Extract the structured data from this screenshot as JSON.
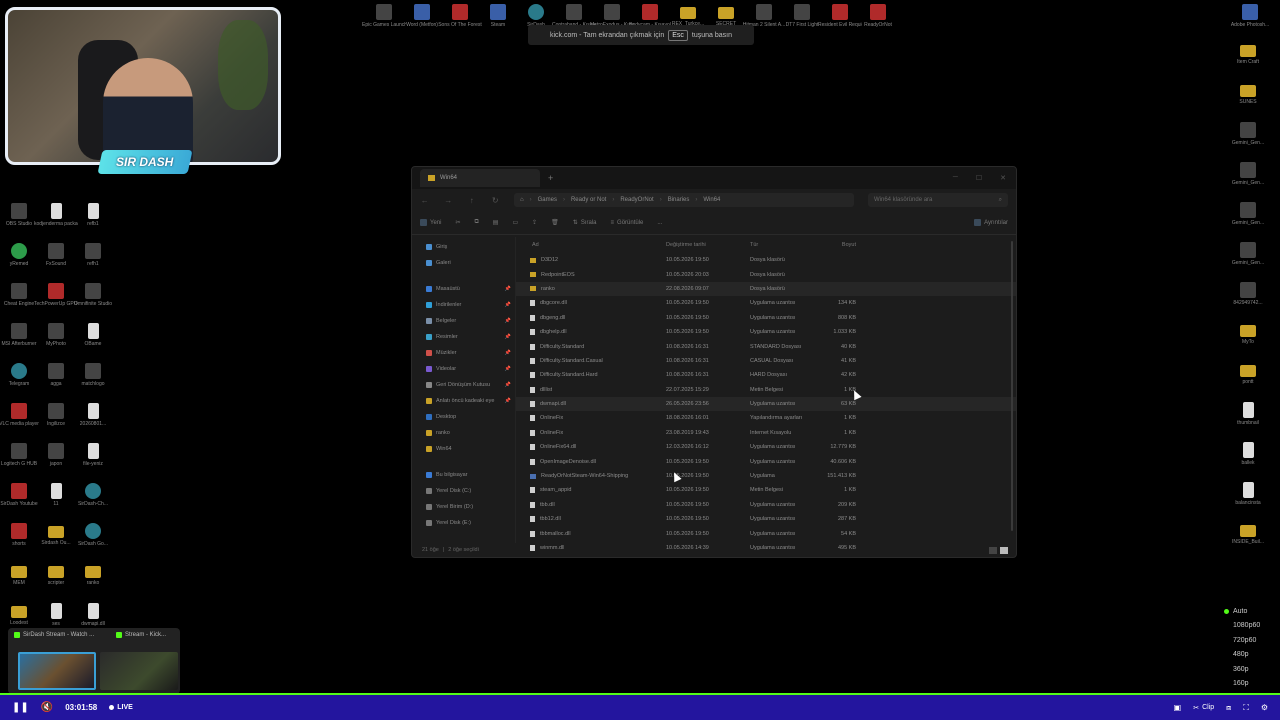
{
  "toast": {
    "text_before": "kick.com - Tam ekrandan çıkmak için",
    "key": "Esc",
    "text_after": "tuşuna basın"
  },
  "webcam": {
    "badge": "SIR DASH"
  },
  "desktop_top": [
    {
      "label": "Epic Games Launcher",
      "kind": "dark"
    },
    {
      "label": "Word (Metfon)",
      "kind": "app"
    },
    {
      "label": "Sons Of The Forest",
      "kind": "red"
    },
    {
      "label": "Steam",
      "kind": "app"
    },
    {
      "label": "SirDash",
      "kind": "teal"
    },
    {
      "label": "Contraband - Kısayol",
      "kind": "dark"
    },
    {
      "label": "MetroExodus - Kısayol",
      "kind": "dark"
    },
    {
      "label": "Bodycam - Kısayol",
      "kind": "red"
    },
    {
      "label": "REX_Turkce...",
      "kind": "folder"
    },
    {
      "label": "SECRET",
      "kind": "folder"
    },
    {
      "label": "Hitman 2 Silent A...",
      "kind": "dark"
    },
    {
      "label": "DT7 First Light",
      "kind": "dark"
    },
    {
      "label": "Resident Evil Requiem",
      "kind": "red"
    },
    {
      "label": "ReadyOrNot",
      "kind": "red"
    },
    {
      "label": "Adobe Photosh...",
      "kind": "app"
    }
  ],
  "desktop_left": [
    {
      "label": "OBS Studio",
      "kind": "dark"
    },
    {
      "label": "kodjenderma packagedel...",
      "kind": "file"
    },
    {
      "label": "refb1",
      "kind": "file"
    },
    {
      "label": "yRemed",
      "kind": "green"
    },
    {
      "label": "FxSound",
      "kind": "dark"
    },
    {
      "label": "refh1",
      "kind": "dark"
    },
    {
      "label": "Cheat Engine",
      "kind": "dark"
    },
    {
      "label": "TechPowerUp GPU-Z",
      "kind": "red"
    },
    {
      "label": "Omnifinite Studio",
      "kind": "dark"
    },
    {
      "label": "MSI Afterburner",
      "kind": "dark"
    },
    {
      "label": "MyPhoto",
      "kind": "dark"
    },
    {
      "label": "OBame",
      "kind": "file"
    },
    {
      "label": "Telegram",
      "kind": "teal"
    },
    {
      "label": "agga",
      "kind": "dark"
    },
    {
      "label": "matchlogo",
      "kind": "dark"
    },
    {
      "label": "VLC media player",
      "kind": "red"
    },
    {
      "label": "İngilizce",
      "kind": "dark"
    },
    {
      "label": "20260801...",
      "kind": "file"
    },
    {
      "label": "Logitech G HUB",
      "kind": "dark"
    },
    {
      "label": "japon",
      "kind": "dark"
    },
    {
      "label": "file-yeniz",
      "kind": "file"
    },
    {
      "label": "SirDash Youtube",
      "kind": "red"
    },
    {
      "label": "11",
      "kind": "file"
    },
    {
      "label": "SirDash-Ch...",
      "kind": "teal"
    },
    {
      "label": "shorts",
      "kind": "red"
    },
    {
      "label": "Sirdash Ou...",
      "kind": "folder"
    },
    {
      "label": "SirDash Go...",
      "kind": "teal"
    },
    {
      "label": "MEM",
      "kind": "folder"
    },
    {
      "label": "scripter",
      "kind": "folder"
    },
    {
      "label": "ranko",
      "kind": "folder"
    },
    {
      "label": "Loodest",
      "kind": "folder"
    },
    {
      "label": "ses",
      "kind": "file"
    },
    {
      "label": "dwmapi.dll",
      "kind": "file"
    }
  ],
  "desktop_right": [
    {
      "label": "Item Craft",
      "kind": "folder"
    },
    {
      "label": "SUNES",
      "kind": "folder"
    },
    {
      "label": "Gemini_Gen...",
      "kind": "dark"
    },
    {
      "label": "Gemini_Gen...",
      "kind": "dark"
    },
    {
      "label": "Gemini_Gen...",
      "kind": "dark"
    },
    {
      "label": "Gemini_Gen...",
      "kind": "dark"
    },
    {
      "label": "842949742...",
      "kind": "dark"
    },
    {
      "label": "MyTo",
      "kind": "folder"
    },
    {
      "label": "pontt",
      "kind": "folder"
    },
    {
      "label": "thumbnail",
      "kind": "file"
    },
    {
      "label": "ballek",
      "kind": "file"
    },
    {
      "label": "balancinsta",
      "kind": "file"
    },
    {
      "label": "INSIDE_Buil...",
      "kind": "folder"
    }
  ],
  "explorer": {
    "tab_title": "Win64",
    "path": [
      "Games",
      "Ready or Not",
      "ReadyOrNot",
      "Binaries",
      "Win64"
    ],
    "search_placeholder": "Win64 klasöründe ara",
    "toolbar": {
      "new": "Yeni",
      "sort": "Sırala",
      "view": "Görüntüle",
      "more": "...",
      "details": "Ayrıntılar"
    },
    "nav_pane": {
      "top": [
        {
          "label": "Giriş",
          "icon": "home"
        },
        {
          "label": "Galeri",
          "icon": "gallery"
        }
      ],
      "quick": [
        {
          "label": "Masaüstü",
          "pinned": true
        },
        {
          "label": "İndirilenler",
          "pinned": true
        },
        {
          "label": "Belgeler",
          "pinned": true
        },
        {
          "label": "Resimler",
          "pinned": true
        },
        {
          "label": "Müzikler",
          "pinned": true
        },
        {
          "label": "Videolar",
          "pinned": true
        },
        {
          "label": "Geri Dönüşüm Kutusu",
          "pinned": true
        },
        {
          "label": "Anlatı öncü kadeaki eye",
          "pinned": true
        },
        {
          "label": "Desktop",
          "pinned": false
        },
        {
          "label": "ranko",
          "pinned": false
        },
        {
          "label": "Win64",
          "pinned": false
        }
      ],
      "this_pc": "Bu bilgisayar",
      "drives": [
        "Yerel Disk (C:)",
        "Yerel Birim (D:)",
        "Yerel Disk (E:)"
      ]
    },
    "columns": {
      "name": "Ad",
      "date": "Değiştirme tarihi",
      "type": "Tür",
      "size": "Boyut"
    },
    "files": [
      {
        "name": "D3D12",
        "date": "10.05.2026 19:50",
        "type": "Dosya klasörü",
        "size": "",
        "kind": "folder",
        "selected": false
      },
      {
        "name": "RedpointEOS",
        "date": "10.05.2026 20:03",
        "type": "Dosya klasörü",
        "size": "",
        "kind": "folder",
        "selected": false
      },
      {
        "name": "ranko",
        "date": "22.08.2026 09:07",
        "type": "Dosya klasörü",
        "size": "",
        "kind": "folder",
        "selected": true
      },
      {
        "name": "dbgcore.dll",
        "date": "10.05.2026 19:50",
        "type": "Uygulama uzantısı",
        "size": "134 KB",
        "kind": "file",
        "selected": false
      },
      {
        "name": "dbgeng.dll",
        "date": "10.05.2026 19:50",
        "type": "Uygulama uzantısı",
        "size": "808 KB",
        "kind": "file",
        "selected": false
      },
      {
        "name": "dbghelp.dll",
        "date": "10.05.2026 19:50",
        "type": "Uygulama uzantısı",
        "size": "1.033 KB",
        "kind": "file",
        "selected": false
      },
      {
        "name": "Difficulty.Standard",
        "date": "10.08.2026 16:31",
        "type": "STANDARD Dosyası",
        "size": "40 KB",
        "kind": "file",
        "selected": false
      },
      {
        "name": "Difficulty.Standard.Casual",
        "date": "10.08.2026 16:31",
        "type": "CASUAL Dosyası",
        "size": "41 KB",
        "kind": "file",
        "selected": false
      },
      {
        "name": "Difficulty.Standard.Hard",
        "date": "10.08.2026 16:31",
        "type": "HARD Dosyası",
        "size": "42 KB",
        "kind": "file",
        "selected": false
      },
      {
        "name": "dlllist",
        "date": "22.07.2025 15:29",
        "type": "Metin Belgesi",
        "size": "1 KB",
        "kind": "file",
        "selected": false
      },
      {
        "name": "dwmapi.dll",
        "date": "26.05.2026 23:56",
        "type": "Uygulama uzantısı",
        "size": "63 KB",
        "kind": "file",
        "selected": true
      },
      {
        "name": "OnlineFix",
        "date": "18.08.2026 16:01",
        "type": "Yapılandırma ayarları",
        "size": "1 KB",
        "kind": "file",
        "selected": false
      },
      {
        "name": "OnlineFix",
        "date": "23.08.2019 19:43",
        "type": "Internet Kısayolu",
        "size": "1 KB",
        "kind": "file",
        "selected": false
      },
      {
        "name": "OnlineFix64.dll",
        "date": "12.03.2026 16:12",
        "type": "Uygulama uzantısı",
        "size": "12.779 KB",
        "kind": "file",
        "selected": false
      },
      {
        "name": "OpenImageDenoise.dll",
        "date": "10.05.2026 19:50",
        "type": "Uygulama uzantısı",
        "size": "40.606 KB",
        "kind": "file",
        "selected": false
      },
      {
        "name": "ReadyOrNotSteam-Win64-Shipping",
        "date": "10.05.2026 19:50",
        "type": "Uygulama",
        "size": "151.413 KB",
        "kind": "exe",
        "selected": false
      },
      {
        "name": "steam_appid",
        "date": "10.05.2026 19:50",
        "type": "Metin Belgesi",
        "size": "1 KB",
        "kind": "file",
        "selected": false
      },
      {
        "name": "tbb.dll",
        "date": "10.05.2026 19:50",
        "type": "Uygulama uzantısı",
        "size": "209 KB",
        "kind": "file",
        "selected": false
      },
      {
        "name": "tbb12.dll",
        "date": "10.05.2026 19:50",
        "type": "Uygulama uzantısı",
        "size": "287 KB",
        "kind": "file",
        "selected": false
      },
      {
        "name": "tbbmalloc.dll",
        "date": "10.05.2026 19:50",
        "type": "Uygulama uzantısı",
        "size": "54 KB",
        "kind": "file",
        "selected": false
      },
      {
        "name": "winmm.dll",
        "date": "10.05.2026 14:39",
        "type": "Uygulama uzantısı",
        "size": "495 KB",
        "kind": "file",
        "selected": false
      }
    ],
    "status": {
      "count": "21 öğe",
      "selected": "2 öğe seçildi"
    }
  },
  "quality_menu": [
    "Auto",
    "1080p60",
    "720p60",
    "480p",
    "360p",
    "160p"
  ],
  "thumbnails": [
    {
      "label": "SirDash Stream - Watch ..."
    },
    {
      "label": "Stream - Kick..."
    }
  ],
  "player": {
    "time": "03:01:58",
    "live": "LIVE",
    "clip": "Clip",
    "progress": 1.0,
    "accent": "#53fc18",
    "bar_color": "#23159e"
  }
}
